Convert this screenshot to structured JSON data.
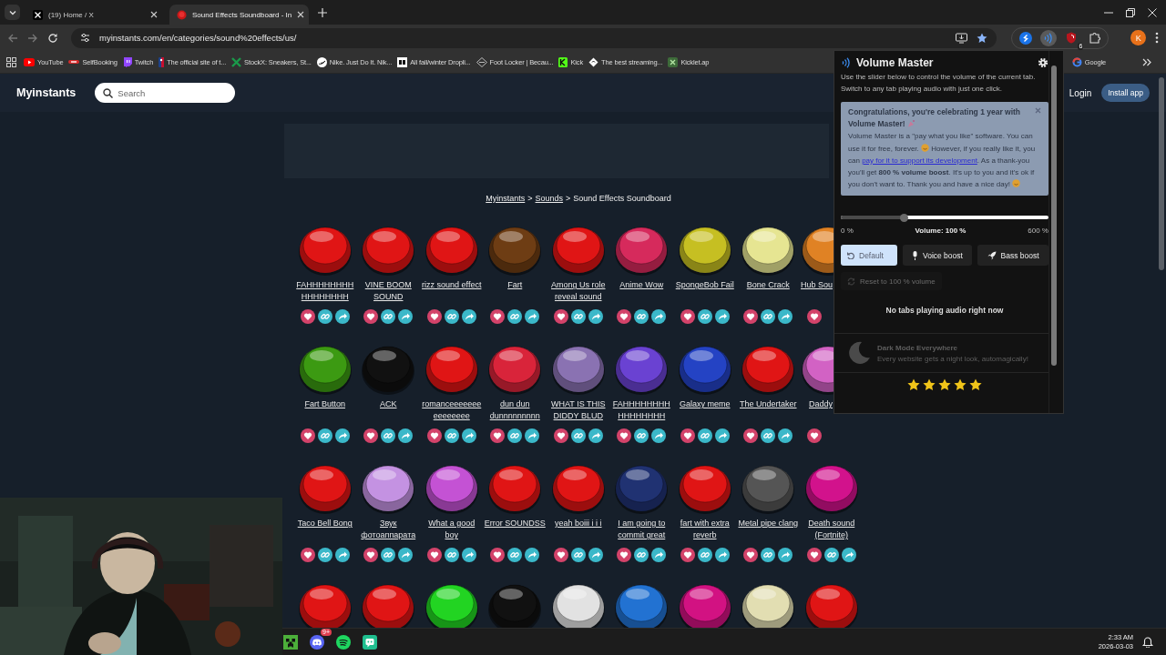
{
  "browser": {
    "tabs": [
      {
        "title": "(19) Home / X",
        "selected": false
      },
      {
        "title": "Sound Effects Soundboard - In",
        "selected": true
      }
    ],
    "url": "myinstants.com/en/categories/sound%20effects/us/",
    "extensions": [
      {
        "selected": false
      },
      {
        "selected": true
      },
      {
        "selected": false,
        "badge": "6"
      },
      {
        "selected": false
      }
    ],
    "profile_initial": "K",
    "bookmarks": [
      {
        "label": "YouTube"
      },
      {
        "label": "SelfBooking"
      },
      {
        "label": "Twitch"
      },
      {
        "label": "The official site of t..."
      },
      {
        "label": "StockX: Sneakers, St..."
      },
      {
        "label": "Nike. Just Do It. Nik..."
      },
      {
        "label": "All fall/winter Dropli..."
      },
      {
        "label": "Foot Locker | Becau..."
      },
      {
        "label": "Kick"
      },
      {
        "label": "The best streaming..."
      },
      {
        "label": "Kicklet.ap"
      }
    ],
    "bookmarks_right": [
      {
        "label": "Google"
      }
    ]
  },
  "site": {
    "logo": "Myinstants",
    "search_placeholder": "Search",
    "login": "Login",
    "install": "Install app",
    "breadcrumb": [
      {
        "text": "Myinstants",
        "kind": "link"
      },
      {
        "text": ">",
        "kind": "separator"
      },
      {
        "text": "Sounds",
        "kind": "link"
      },
      {
        "text": ">",
        "kind": "separator"
      },
      {
        "text": "Sound Effects Soundboard",
        "kind": "current"
      }
    ],
    "rows": [
      {
        "items": [
          {
            "label": "FAHHHHHHHHHHHHHHHH",
            "color": "#e01515"
          },
          {
            "label": "VINE BOOM SOUND",
            "color": "#e01515"
          },
          {
            "label": "rizz sound effect",
            "color": "#e01515"
          },
          {
            "label": "Fart",
            "color": "#6e3d14"
          },
          {
            "label": "Among Us role reveal sound",
            "color": "#e01515"
          },
          {
            "label": "Anime Wow",
            "color": "#d62a5c"
          },
          {
            "label": "SpongeBob Fail",
            "color": "#c6bf22"
          },
          {
            "label": "Bone Crack",
            "color": "#e6e592"
          },
          {
            "label": "Hub Sou",
            "color": "#e08224",
            "cut": true
          }
        ]
      },
      {
        "items": [
          {
            "label": "Fart Button",
            "color": "#3c9a12"
          },
          {
            "label": "ACK",
            "color": "#111111"
          },
          {
            "label": "romanceeeeeeeeeeeeeee",
            "color": "#e01515"
          },
          {
            "label": "dun dun dunnnnnnnnn",
            "color": "#d9243a"
          },
          {
            "label": "WHAT IS THIS DIDDY BLUD",
            "color": "#8a72b2"
          },
          {
            "label": "FAHHHHHHHHHHHHHHHH",
            "color": "#6a42d2"
          },
          {
            "label": "Galaxy meme",
            "color": "#2443c4"
          },
          {
            "label": "The Undertaker",
            "color": "#e01515"
          },
          {
            "label": "Daddy",
            "color": "#d262c4",
            "cut": true
          }
        ]
      },
      {
        "items": [
          {
            "label": "Taco Bell Bong",
            "color": "#e01515"
          },
          {
            "label": "Звук фотоаппарата",
            "color": "#c492e2"
          },
          {
            "label": "What a good boy",
            "color": "#c452d4"
          },
          {
            "label": "Error SOUNDSS",
            "color": "#e01515"
          },
          {
            "label": "yeah boiii i i i",
            "color": "#e01515"
          },
          {
            "label": "I am going to commit great",
            "color": "#203272"
          },
          {
            "label": "fart with extra reverb",
            "color": "#e01515"
          },
          {
            "label": "Metal pipe clang",
            "color": "#555555"
          },
          {
            "label": "Death sound (Fortnite)",
            "color": "#d2128c"
          }
        ]
      },
      {
        "items": [
          {
            "color": "#e01515"
          },
          {
            "color": "#e01515"
          },
          {
            "color": "#22d422"
          },
          {
            "color": "#111111"
          },
          {
            "color": "#e2e2e2"
          },
          {
            "color": "#2272d2"
          },
          {
            "color": "#d21282"
          },
          {
            "color": "#e2deb2"
          },
          {
            "color": "#e01515"
          }
        ]
      }
    ]
  },
  "popup": {
    "title": "Volume Master",
    "description": "Use the slider below to control the volume of the current tab. Switch to any tab playing audio with just one click.",
    "notice": {
      "title": "Congratulations, you're celebrating 1 year with Volume Master!",
      "text_1": "Volume Master is a \"pay what you like\" software. You can use it for free, forever.",
      "text_2": "However, if you really like it, you can",
      "link": "pay for it to support its development",
      "text_3": ". As a thank-you you'll get **800 % volume boost**. It's up to you and it's ok if you don't want to. Thank you and have a nice day!"
    },
    "slider": {
      "level": 0.29,
      "min_label": "0 %",
      "value_label": "Volume: 100 %",
      "max_label": "600 %"
    },
    "modes": [
      {
        "label": "Default",
        "selected": true
      },
      {
        "label": "Voice boost",
        "selected": false
      },
      {
        "label": "Bass boost",
        "selected": false
      }
    ],
    "reset": {
      "label": "Reset to 100 % volume",
      "disabled": true
    },
    "status": "No tabs playing audio right now",
    "promo": {
      "title": "Dark Mode Everywhere",
      "text": "Every website gets a night look, automagically!"
    },
    "rating": {
      "stars": 5
    }
  },
  "taskbar": {
    "chat_app_badge": "9+",
    "time": "2:33 AM",
    "date": "2026-03-03"
  }
}
